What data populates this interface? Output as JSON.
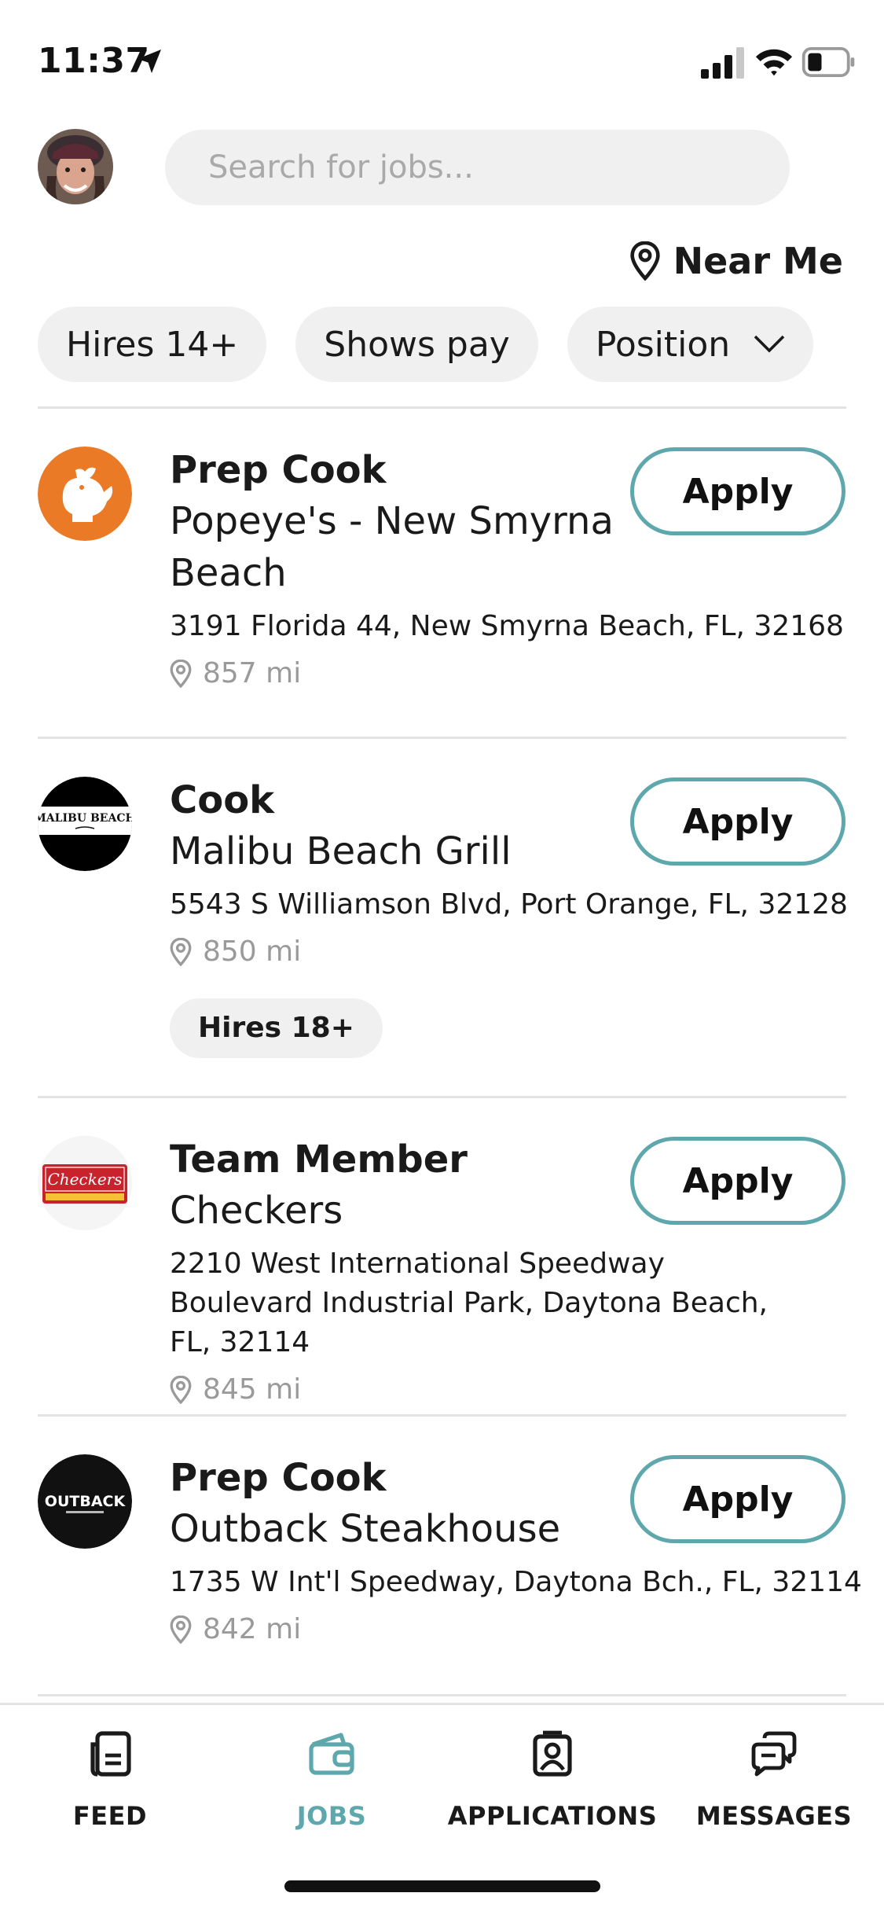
{
  "status_bar": {
    "time": "11:37"
  },
  "search": {
    "placeholder": "Search for jobs..."
  },
  "location": {
    "label": "Near Me"
  },
  "filters": [
    {
      "label": "Hires 14+"
    },
    {
      "label": "Shows pay"
    },
    {
      "label": "Position"
    }
  ],
  "jobs": [
    {
      "title": "Prep Cook",
      "company": "Popeye's - New Smyrna Beach",
      "address": "3191 Florida 44, New Smyrna Beach, FL, 32168",
      "distance": "857 mi",
      "logo": "popeyes-logo",
      "apply_label": "Apply"
    },
    {
      "title": "Cook",
      "company": "Malibu Beach Grill",
      "address": "5543 S Williamson Blvd, Port Orange, FL, 32128",
      "distance": "850 mi",
      "tag": "Hires 18+",
      "logo": "malibu-beach-grill-logo",
      "logo_text": "MALIBU BEACH",
      "apply_label": "Apply"
    },
    {
      "title": "Team Member",
      "company": "Checkers",
      "address": "2210 West International Speedway Boulevard Industrial Park, Daytona Beach, FL, 32114",
      "distance": "845 mi",
      "logo": "checkers-logo",
      "logo_text": "Checkers",
      "apply_label": "Apply"
    },
    {
      "title": "Prep Cook",
      "company": "Outback Steakhouse",
      "address": "1735 W Int'l Speedway, Daytona Bch., FL, 32114",
      "distance": "842 mi",
      "logo": "outback-logo",
      "logo_text": "OUTBACK",
      "apply_label": "Apply"
    }
  ],
  "tabs": [
    {
      "label": "FEED",
      "icon": "feed-icon",
      "active": false
    },
    {
      "label": "JOBS",
      "icon": "wallet-icon",
      "active": true
    },
    {
      "label": "APPLICATIONS",
      "icon": "applications-icon",
      "active": false
    },
    {
      "label": "MESSAGES",
      "icon": "messages-icon",
      "active": false
    }
  ],
  "colors": {
    "accent": "#5ea8ad",
    "chip_bg": "#f0f0f0",
    "popeyes_orange": "#ea7a26"
  }
}
